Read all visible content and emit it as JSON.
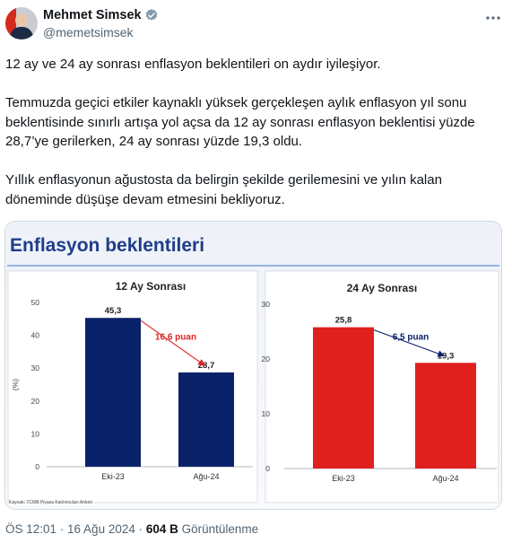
{
  "author": {
    "name": "Mehmet Simsek",
    "handle": "@memetsimsek"
  },
  "tweet": {
    "text": "12 ay ve 24 ay sonrası enflasyon beklentileri on aydır iyileşiyor.\n\nTemmuzda geçici etkiler kaynaklı yüksek gerçekleşen aylık enflasyon yıl sonu beklentisinde sınırlı artışa yol açsa da 12 ay sonrası enflasyon beklentisi yüzde 28,7’ye gerilerken, 24 ay sonrası yüzde 19,3 oldu.\n\nYıllık enflasyonun ağustosta da belirgin şekilde gerilemesini ve yılın kalan döneminde düşüşe devam etmesini bekliyoruz."
  },
  "card": {
    "title": "Enflasyon beklentileri",
    "source": "Kaynak: TCMB Piyasa Katılımcıları Anketi"
  },
  "chart_data": [
    {
      "type": "bar",
      "title": "12 Ay Sonrası",
      "ylabel": "(%)",
      "categories": [
        "Eki-23",
        "Ağu-24"
      ],
      "values": [
        45.3,
        28.7
      ],
      "value_labels": [
        "45,3",
        "28,7"
      ],
      "ylim": [
        0,
        50
      ],
      "yticks": [
        "0",
        "10",
        "20",
        "30",
        "40",
        "50"
      ],
      "color": "#0a2269",
      "annotation": "16,6 puan",
      "annotation_color": "#e02323",
      "grid": false
    },
    {
      "type": "bar",
      "title": "24 Ay Sonrası",
      "ylabel": "",
      "categories": [
        "Eki-23",
        "Ağu-24"
      ],
      "values": [
        25.8,
        19.3
      ],
      "value_labels": [
        "25,8",
        "19,3"
      ],
      "ylim": [
        0,
        30
      ],
      "yticks": [
        "0",
        "10",
        "20",
        "30"
      ],
      "color": "#e01f1f",
      "annotation": "6,5 puan",
      "annotation_color": "#0a2269",
      "grid": false
    }
  ],
  "footer": {
    "time": "ÖS 12:01 · 16 Ağu 2024 · ",
    "views": "604 B",
    "views_label": " Görüntülenme"
  }
}
